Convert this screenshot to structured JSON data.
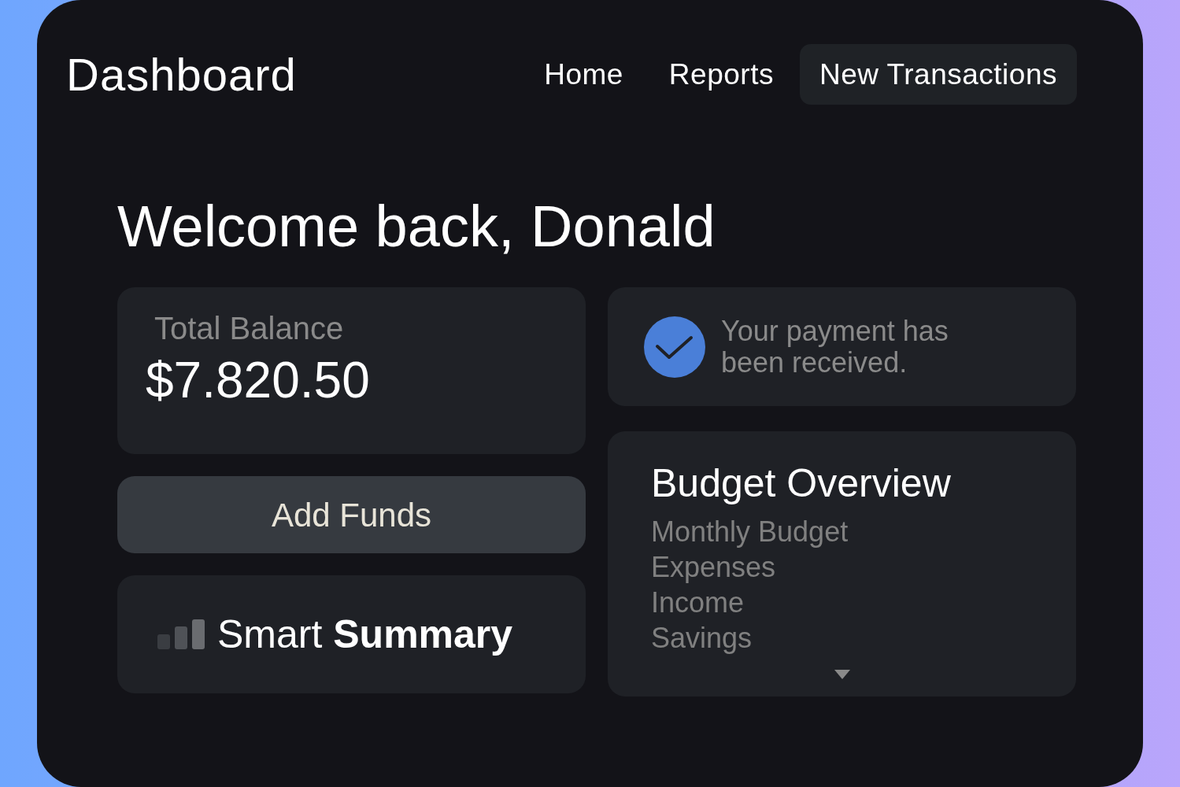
{
  "header": {
    "title": "Dashboard",
    "nav": [
      {
        "label": "Home",
        "selected": false
      },
      {
        "label": "Reports",
        "selected": false
      },
      {
        "label": "New Transactions",
        "selected": true
      }
    ]
  },
  "greeting": "Welcome back, Donald",
  "balance_card": {
    "label": "Total Balance",
    "amount": "$7.820.50"
  },
  "add_funds_button": {
    "label": "Add Funds"
  },
  "smart_summary": {
    "title": "Smart **Summary**"
  },
  "notification": {
    "message": "Your payment has been received."
  },
  "budget_overview": {
    "title": "Budget Overview",
    "items": [
      "Monthly Budget",
      "Expenses",
      "Income",
      "Savings"
    ]
  }
}
